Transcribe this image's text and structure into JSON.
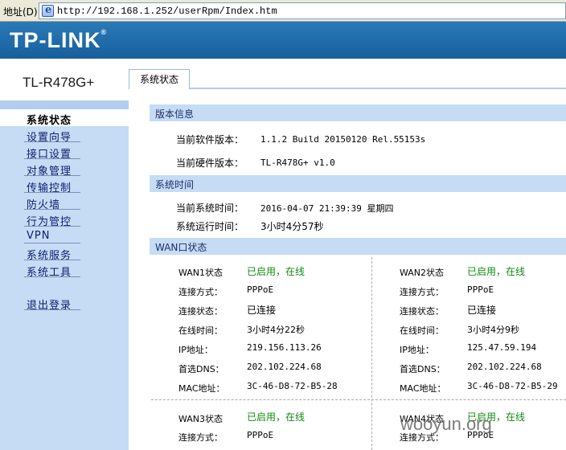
{
  "browser": {
    "address_label": "地址(D)",
    "url": "http://192.168.1.252/userRpm/Index.htm"
  },
  "brand": {
    "logo": "TP-LINK",
    "model": "TL-R478G+"
  },
  "menu": {
    "items": [
      "系统状态",
      "设置向导",
      "接口设置",
      "对象管理",
      "传输控制",
      "防火墙",
      "行为管控",
      "VPN",
      "系统服务",
      "系统工具"
    ],
    "active": 0,
    "logout": "退出登录"
  },
  "tab": {
    "label": "系统状态"
  },
  "version": {
    "title": "版本信息",
    "software_label": "当前软件版本：",
    "software_value": "1.1.2 Build 20150120 Rel.55153s",
    "hardware_label": "当前硬件版本：",
    "hardware_value": "TL-R478G+ v1.0"
  },
  "time": {
    "title": "系统时间",
    "system_time_label": "当前系统时间：",
    "system_time_value": "2016-04-07 21:39:39 星期四",
    "uptime_label": "系统运行时间：",
    "uptime_value": "3小时4分57秒"
  },
  "wan_title": "WAN口状态",
  "wan_labels": {
    "conn_type": "连接方式：",
    "conn_state": "连接状态：",
    "online_time": "在线时间：",
    "ip": "IP地址：",
    "dns": "首选DNS：",
    "mac": "MAC地址："
  },
  "wan": [
    {
      "name": "WAN1状态",
      "status": "已启用，在线",
      "conn_type": "PPPoE",
      "conn_state": "已连接",
      "online_time": "3小时4分22秒",
      "ip": "219.156.113.26",
      "dns": "202.102.224.68",
      "mac": "3C-46-D8-72-B5-28"
    },
    {
      "name": "WAN2状态",
      "status": "已启用，在线",
      "conn_type": "PPPoE",
      "conn_state": "已连接",
      "online_time": "3小时4分9秒",
      "ip": "125.47.59.194",
      "dns": "202.102.224.68",
      "mac": "3C-46-D8-72-B5-29"
    },
    {
      "name": "WAN3状态",
      "status": "已启用，在线",
      "conn_type": "PPPoE"
    },
    {
      "name": "WAN4状态",
      "status": "已启用，在线",
      "conn_type": "PPPoE"
    }
  ],
  "watermark": "wooyun.org",
  "colors": {
    "banner": "#1d6aa8",
    "menu_bg": "#c6dcf5",
    "status_green": "#118a11"
  }
}
